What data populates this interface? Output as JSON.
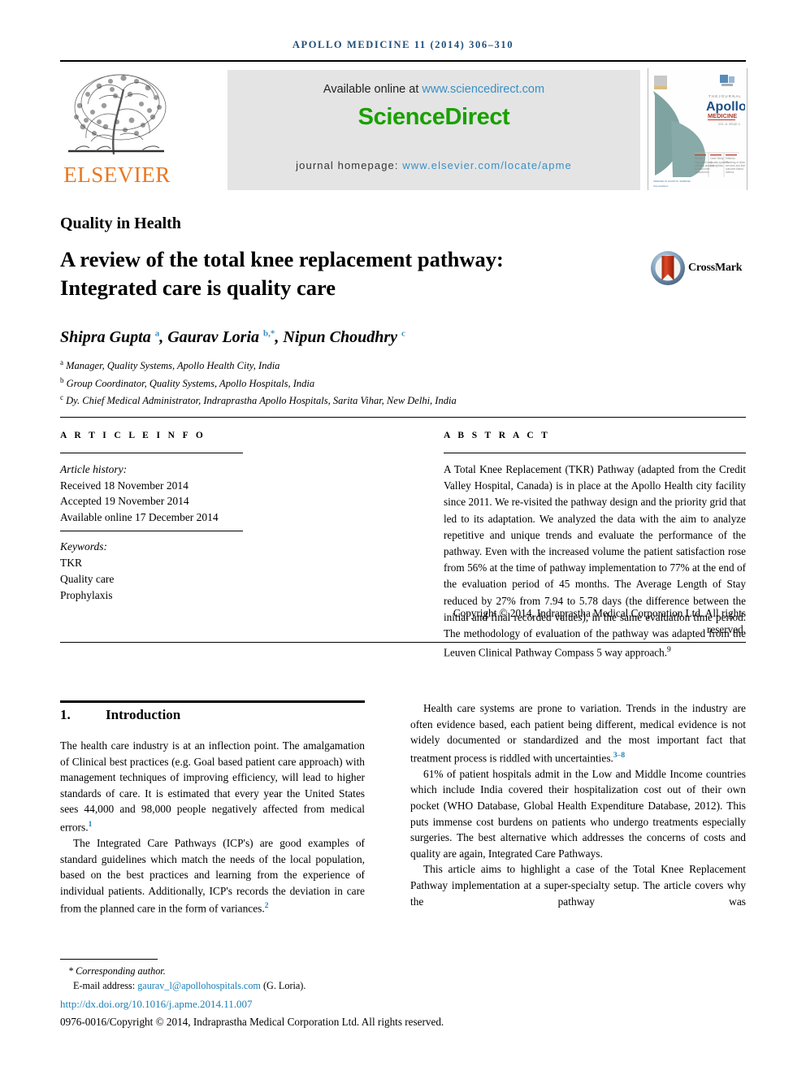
{
  "running_head": "APOLLO MEDICINE 11 (2014) 306–310",
  "masthead": {
    "publisher_name": "ELSEVIER",
    "available_text": "Available online at ",
    "available_link": "www.sciencedirect.com",
    "sciencedirect_logo": "ScienceDirect",
    "homepage_label": "journal homepage: ",
    "homepage_link": "www.elsevier.com/locate/apme",
    "cover_journal_title": "Apollo",
    "cover_journal_sub": "MEDICINE",
    "colors": {
      "elsevier_orange": "#E87722",
      "sciencedirect_green": "#18a000",
      "link_blue": "#3a8fc4",
      "banner_gray": "#e4e4e4",
      "cover_teal": "#6f9b99",
      "runhead_blue": "#1f4e79"
    }
  },
  "article": {
    "section_kicker": "Quality in Health",
    "title": "A review of the total knee replacement pathway: Integrated care is quality care",
    "crossmark_label": "CrossMark",
    "authors_html": "Shipra Gupta <sup>a</sup>, Gaurav Loria <sup>b,*</sup>, Nipun Choudhry <sup>c</sup>",
    "affiliations": [
      {
        "marker": "a",
        "text": "Manager, Quality Systems, Apollo Health City, India"
      },
      {
        "marker": "b",
        "text": "Group Coordinator, Quality Systems, Apollo Hospitals, India"
      },
      {
        "marker": "c",
        "text": "Dy. Chief Medical Administrator, Indraprastha Apollo Hospitals, Sarita Vihar, New Delhi, India"
      }
    ]
  },
  "article_info": {
    "heading": "A R T I C L E   I N F O",
    "history_label": "Article history:",
    "history": [
      "Received 18 November 2014",
      "Accepted 19 November 2014",
      "Available online 17 December 2014"
    ],
    "keywords_label": "Keywords:",
    "keywords": [
      "TKR",
      "Quality care",
      "Prophylaxis"
    ]
  },
  "abstract": {
    "heading": "A B S T R A C T",
    "body": "A Total Knee Replacement (TKR) Pathway (adapted from the Credit Valley Hospital, Canada) is in place at the Apollo Health city facility since 2011. We re-visited the pathway design and the priority grid that led to its adaptation. We analyzed the data with the aim to analyze repetitive and unique trends and evaluate the performance of the pathway. Even with the increased volume the patient satisfaction rose from 56% at the time of pathway implementation to 77% at the end of the evaluation period of 45 months. The Average Length of Stay reduced by 27% from 7.94 to 5.78 days (the difference between the initial and final recorded values), in the same evaluation time period. The methodology of evaluation of the pathway was adapted from the Leuven Clinical Pathway Compass 5 way approach.",
    "body_ref": "9",
    "copyright": "Copyright © 2014, Indraprastha Medical Corporation Ltd. All rights reserved."
  },
  "body": {
    "section_number": "1.",
    "section_title": "Introduction",
    "left_paragraphs": [
      {
        "indent": false,
        "text": "The health care industry is at an inflection point. The amalgamation of Clinical best practices (e.g. Goal based patient care approach) with management techniques of improving efficiency, will lead to higher standards of care. It is estimated that every year the United States sees 44,000 and 98,000 people negatively affected from medical errors.",
        "ref": "1"
      },
      {
        "indent": true,
        "text": "The Integrated Care Pathways (ICP's) are good examples of standard guidelines which match the needs of the local population, based on the best practices and learning from the experience of individual patients. Additionally, ICP's records the deviation in care from the planned care in the form of variances.",
        "ref": "2"
      }
    ],
    "right_paragraphs": [
      {
        "indent": true,
        "text": "Health care systems are prone to variation. Trends in the industry are often evidence based, each patient being different, medical evidence is not widely documented or standardized and the most important fact that treatment process is riddled with uncertainties.",
        "ref": "3–8"
      },
      {
        "indent": true,
        "text": "61% of patient hospitals admit in the Low and Middle Income countries which include India covered their hospitalization cost out of their own pocket (WHO Database, Global Health Expenditure Database, 2012). This puts immense cost burdens on patients who undergo treatments especially surgeries. The best alternative which addresses the concerns of costs and quality are again, Integrated Care Pathways.",
        "ref": ""
      },
      {
        "indent": true,
        "text": "This article aims to highlight a case of the Total Knee Replacement Pathway implementation at a super-specialty setup. The article covers why the pathway was",
        "ref": ""
      }
    ]
  },
  "footer": {
    "corresponding_author": "* Corresponding author.",
    "email_label": "E-mail address: ",
    "email": "gaurav_l@apollohospitals.com",
    "email_suffix": " (G. Loria).",
    "doi": "http://dx.doi.org/10.1016/j.apme.2014.11.007",
    "issn_line": "0976-0016/Copyright © 2014, Indraprastha Medical Corporation Ltd. All rights reserved."
  }
}
